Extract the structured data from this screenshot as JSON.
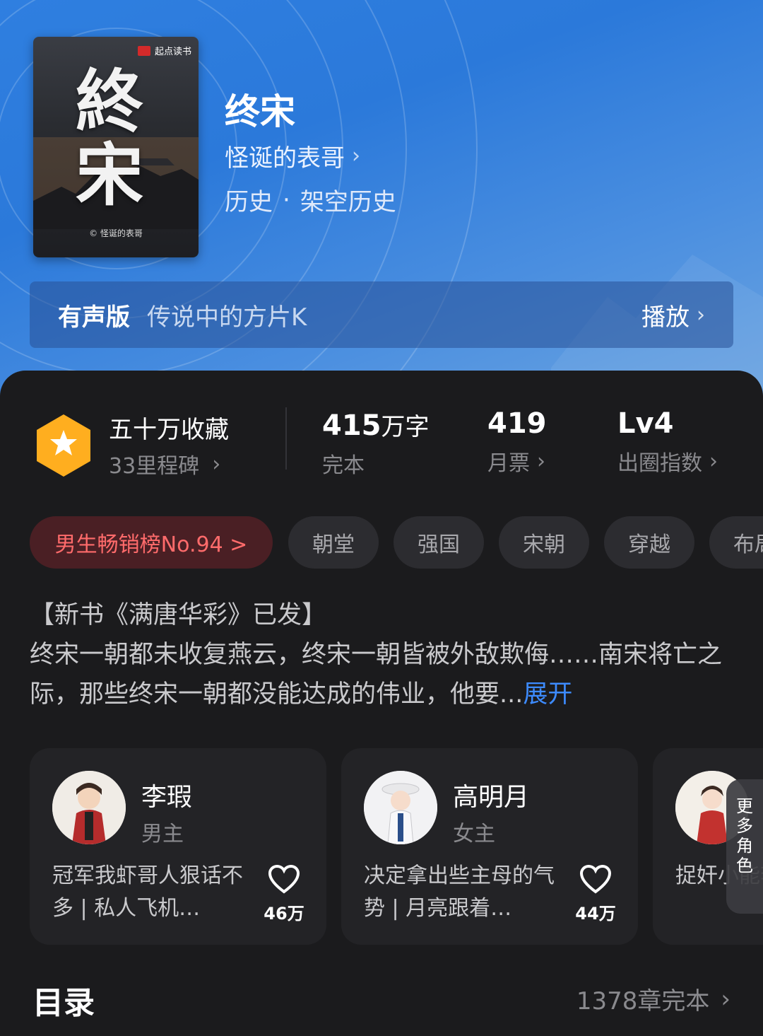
{
  "book": {
    "title": "终宋",
    "author": "怪诞的表哥",
    "genre": "历史",
    "subgenre": "架空历史",
    "cover": {
      "brand": "起点读书",
      "title_chars": [
        "終",
        "宋"
      ],
      "author_credit": "© 怪诞的表哥"
    }
  },
  "audio": {
    "label": "有声版",
    "narrator": "传说中的方片K",
    "play_label": "播放"
  },
  "stats": {
    "collect_title": "五十万收藏",
    "milestone": "33里程碑",
    "word_count_num": "415",
    "word_count_unit": "万字",
    "status": "完本",
    "monthly_tickets": "419",
    "monthly_tickets_label": "月票",
    "level": "Lv4",
    "level_label": "出圈指数"
  },
  "tags": [
    "男生畅销榜No.94 >",
    "朝堂",
    "强国",
    "宋朝",
    "穿越",
    "布局"
  ],
  "description": {
    "line1": "【新书《满唐华彩》已发】",
    "body": "终宋一朝都未收复燕云，终宋一朝皆被外敌欺侮……南宋将亡之际，那些终宋一朝都没能达成的伟业，他要...",
    "expand": "展开"
  },
  "roles": [
    {
      "name": "李瑕",
      "type": "男主",
      "quote": "冠军我虾哥人狠话不多 | 私人飞机…",
      "likes": "46万"
    },
    {
      "name": "高明月",
      "type": "女主",
      "quote": "决定拿出些主母的气势 | 月亮跟着…",
      "likes": "44万"
    },
    {
      "name": "",
      "type": "",
      "quote": "捉奸小能李暇误终",
      "likes": ""
    }
  ],
  "more_roles_label": "更多角色",
  "toc": {
    "title": "目录",
    "info": "1378章完本"
  },
  "colors": {
    "header_blue": "#2f7fe0",
    "accent_blue": "#3d8bff",
    "rank_red": "#ff6b6b",
    "badge_orange": "#ffae1f"
  }
}
